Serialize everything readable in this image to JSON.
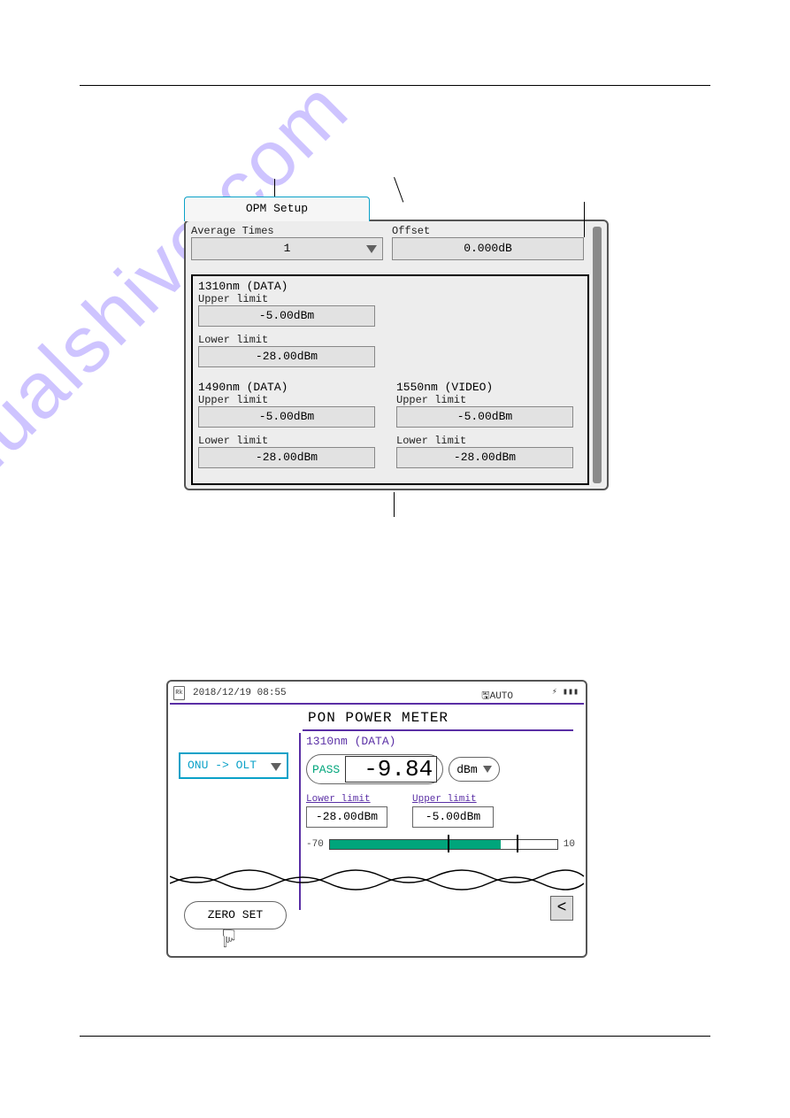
{
  "watermark": "manualshive.com",
  "opm": {
    "tab_label": "OPM Setup",
    "avg_label": "Average Times",
    "avg_value": "1",
    "offset_label": "Offset",
    "offset_value": "0.000dB",
    "sections": {
      "w1310": {
        "title": "1310nm (DATA)",
        "upper_lbl": "Upper limit",
        "upper_val": "-5.00dBm",
        "lower_lbl": "Lower limit",
        "lower_val": "-28.00dBm"
      },
      "w1490": {
        "title": "1490nm (DATA)",
        "upper_lbl": "Upper limit",
        "upper_val": "-5.00dBm",
        "lower_lbl": "Lower limit",
        "lower_val": "-28.00dBm"
      },
      "w1550": {
        "title": "1550nm (VIDEO)",
        "upper_lbl": "Upper limit",
        "upper_val": "-5.00dBm",
        "lower_lbl": "Lower limit",
        "lower_val": "-28.00dBm"
      }
    }
  },
  "pon": {
    "file_badge": "Rk",
    "datetime": "2018/12/19 08:55",
    "auto": "AUTO",
    "batt": "⚡ ▮▮▮",
    "title": "PON POWER METER",
    "measdir": "ONU -> OLT",
    "wave_title": "1310nm (DATA)",
    "pf": "PASS",
    "reading": "-9.84",
    "unit": "dBm",
    "lower_lbl": "Lower limit",
    "lower_val": "-28.00dBm",
    "upper_lbl": "Upper limit",
    "upper_val": "-5.00dBm",
    "bar_min": "-70",
    "bar_max": "10",
    "zero": "ZERO SET",
    "back": "<"
  }
}
